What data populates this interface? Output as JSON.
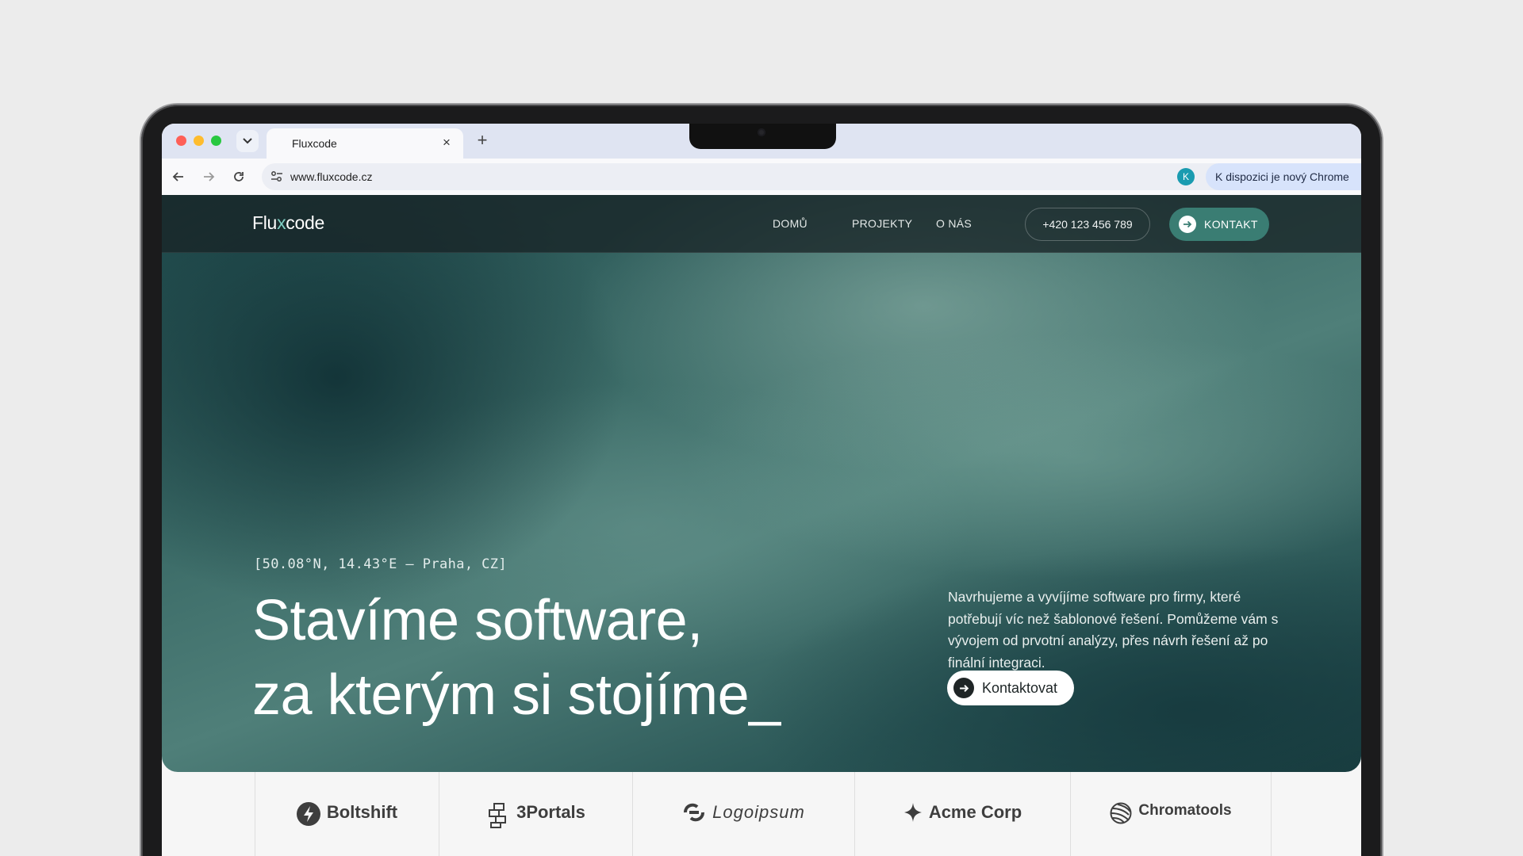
{
  "browser": {
    "tab_title": "Fluxcode",
    "url": "www.fluxcode.cz",
    "profile_initial": "K",
    "update_notice": "K dispozici je nový Chrome"
  },
  "site": {
    "logo": {
      "part1": "Flu",
      "part2": "x",
      "part3": "code"
    },
    "nav": [
      "DOMŮ",
      "PROJEKTY",
      "O NÁS"
    ],
    "phone": "+420 123 456 789",
    "contact_label": "KONTAKT",
    "accent_color": "#3a7d73"
  },
  "hero": {
    "coords": "[50.08°N, 14.43°E — Praha, CZ]",
    "headline_line1": "Stavíme software,",
    "headline_line2": "za kterým si stojíme_",
    "description": "Navrhujeme a vyvíjíme software pro firmy, které potřebují víc než šablonové řešení. Pomůžeme vám s vývojem od prvotní analýzy, přes návrh řešení až po finální integraci.",
    "cta_label": "Kontaktovat"
  },
  "clients": [
    {
      "name": "Boltshift",
      "icon": "bolt-icon"
    },
    {
      "name": "3Portals",
      "icon": "portals-icon"
    },
    {
      "name": "Logoipsum",
      "icon": "logoipsum-icon"
    },
    {
      "name": "Acme Corp",
      "icon": "sparkle-icon"
    },
    {
      "name": "Chromatools",
      "icon": "sphere-icon"
    }
  ]
}
